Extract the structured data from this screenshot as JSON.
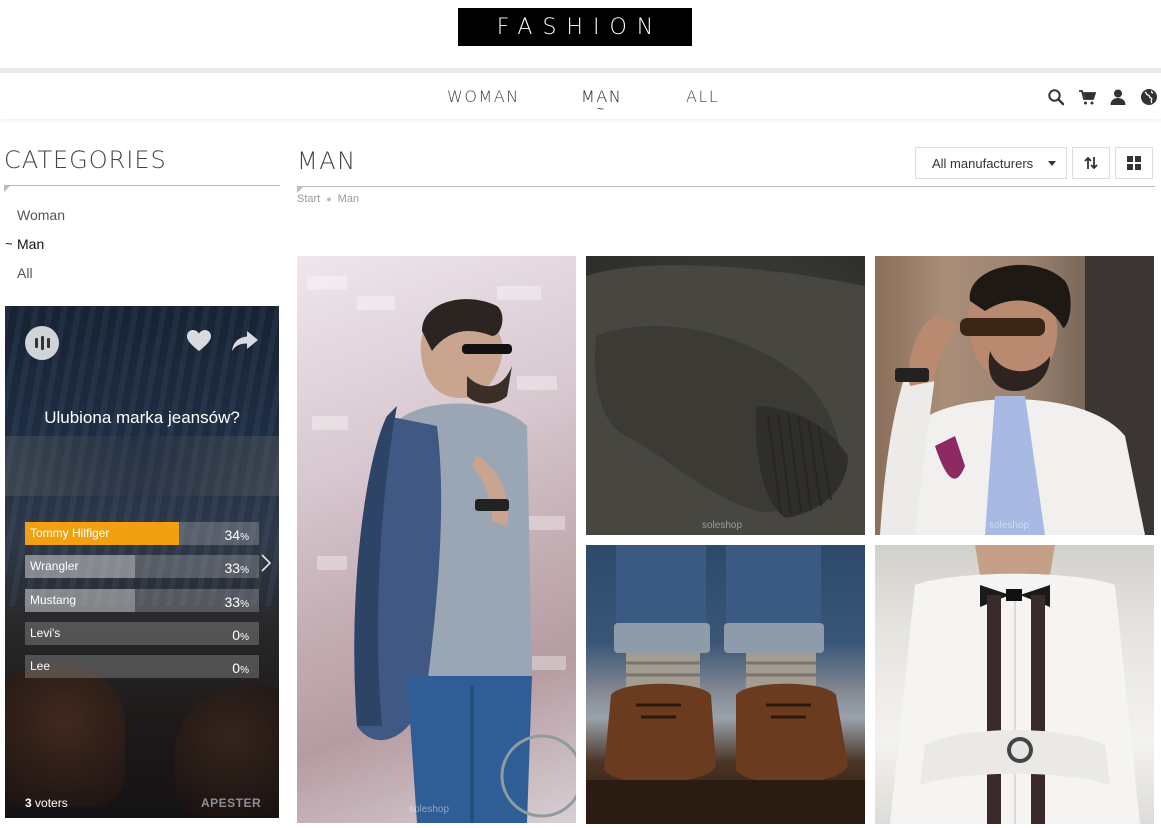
{
  "header": {
    "logo": "FASHION"
  },
  "nav": {
    "items": [
      {
        "label": "WOMAN"
      },
      {
        "label": "MAN",
        "marker": "~"
      },
      {
        "label": "ALL"
      }
    ],
    "icons": [
      "search-icon",
      "cart-icon",
      "user-icon",
      "globe-icon"
    ]
  },
  "sidebar": {
    "title": "CATEGORIES",
    "active_marker": "~",
    "categories": [
      {
        "label": "Woman"
      },
      {
        "label": "Man",
        "active": true
      },
      {
        "label": "All"
      }
    ]
  },
  "poll": {
    "question": "Ulubiona marka jeansów?",
    "options": [
      {
        "label": "Tommy Hilfiger",
        "percent": 34,
        "percent_text": "34",
        "leading": true
      },
      {
        "label": "Wrangler",
        "percent": 33,
        "percent_text": "33"
      },
      {
        "label": "Mustang",
        "percent": 33,
        "percent_text": "33"
      },
      {
        "label": "Levi's",
        "percent": 0,
        "percent_text": "0"
      },
      {
        "label": "Lee",
        "percent": 0,
        "percent_text": "0"
      }
    ],
    "percent_sign": "%",
    "voters_count": "3",
    "voters_label": "voters",
    "brand": "APESTER",
    "accent_color": "#f0a011"
  },
  "main": {
    "title": "MAN",
    "breadcrumb": [
      "Start",
      "Man"
    ],
    "manufacturer_filter": "All manufacturers",
    "watermark": "soleshop"
  }
}
